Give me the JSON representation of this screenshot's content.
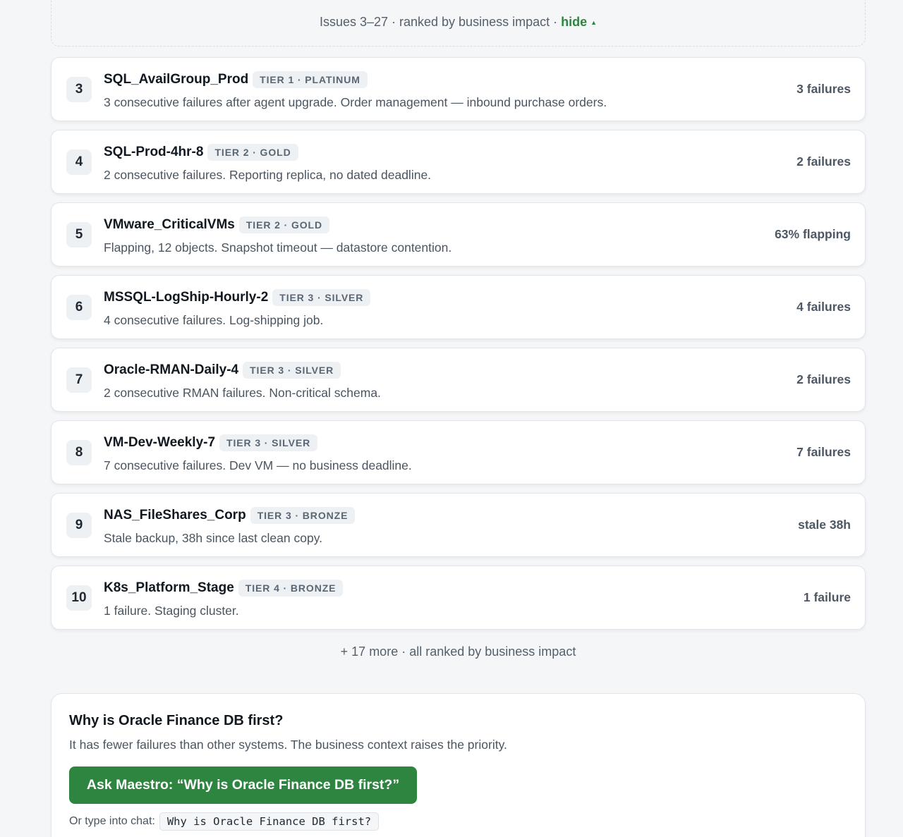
{
  "summary": {
    "text": "Issues 3–27 · ranked by business impact ·",
    "hide_label": "hide",
    "caret_icon": "▲"
  },
  "issues": [
    {
      "rank": "3",
      "name": "SQL_AvailGroup_Prod",
      "tier": "TIER 1 · PLATINUM",
      "description": "3 consecutive failures after agent upgrade. Order management — inbound purchase orders.",
      "metric": "3 failures"
    },
    {
      "rank": "4",
      "name": "SQL-Prod-4hr-8",
      "tier": "TIER 2 · GOLD",
      "description": "2 consecutive failures. Reporting replica, no dated deadline.",
      "metric": "2 failures"
    },
    {
      "rank": "5",
      "name": "VMware_CriticalVMs",
      "tier": "TIER 2 · GOLD",
      "description": "Flapping, 12 objects. Snapshot timeout — datastore contention.",
      "metric": "63% flapping"
    },
    {
      "rank": "6",
      "name": "MSSQL-LogShip-Hourly-2",
      "tier": "TIER 3 · SILVER",
      "description": "4 consecutive failures. Log-shipping job.",
      "metric": "4 failures"
    },
    {
      "rank": "7",
      "name": "Oracle-RMAN-Daily-4",
      "tier": "TIER 3 · SILVER",
      "description": "2 consecutive RMAN failures. Non-critical schema.",
      "metric": "2 failures"
    },
    {
      "rank": "8",
      "name": "VM-Dev-Weekly-7",
      "tier": "TIER 3 · SILVER",
      "description": "7 consecutive failures. Dev VM — no business deadline.",
      "metric": "7 failures"
    },
    {
      "rank": "9",
      "name": "NAS_FileShares_Corp",
      "tier": "TIER 3 · BRONZE",
      "description": "Stale backup, 38h since last clean copy.",
      "metric": "stale 38h"
    },
    {
      "rank": "10",
      "name": "K8s_Platform_Stage",
      "tier": "TIER 4 · BRONZE",
      "description": "1 failure. Staging cluster.",
      "metric": "1 failure"
    }
  ],
  "more": "+ 17 more · all ranked by business impact",
  "why": {
    "title": "Why is Oracle Finance DB first?",
    "body": "It has fewer failures than other systems. The business context raises the priority.",
    "button_label": "Ask Maestro: “Why is Oracle Finance DB first?”",
    "chat_hint": "Or type into chat:",
    "chat_code": "Why is Oracle Finance DB first?"
  },
  "colors": {
    "accent": "#2e8540",
    "background": "#f4f6f8",
    "badge_bg": "#eef1f4"
  }
}
